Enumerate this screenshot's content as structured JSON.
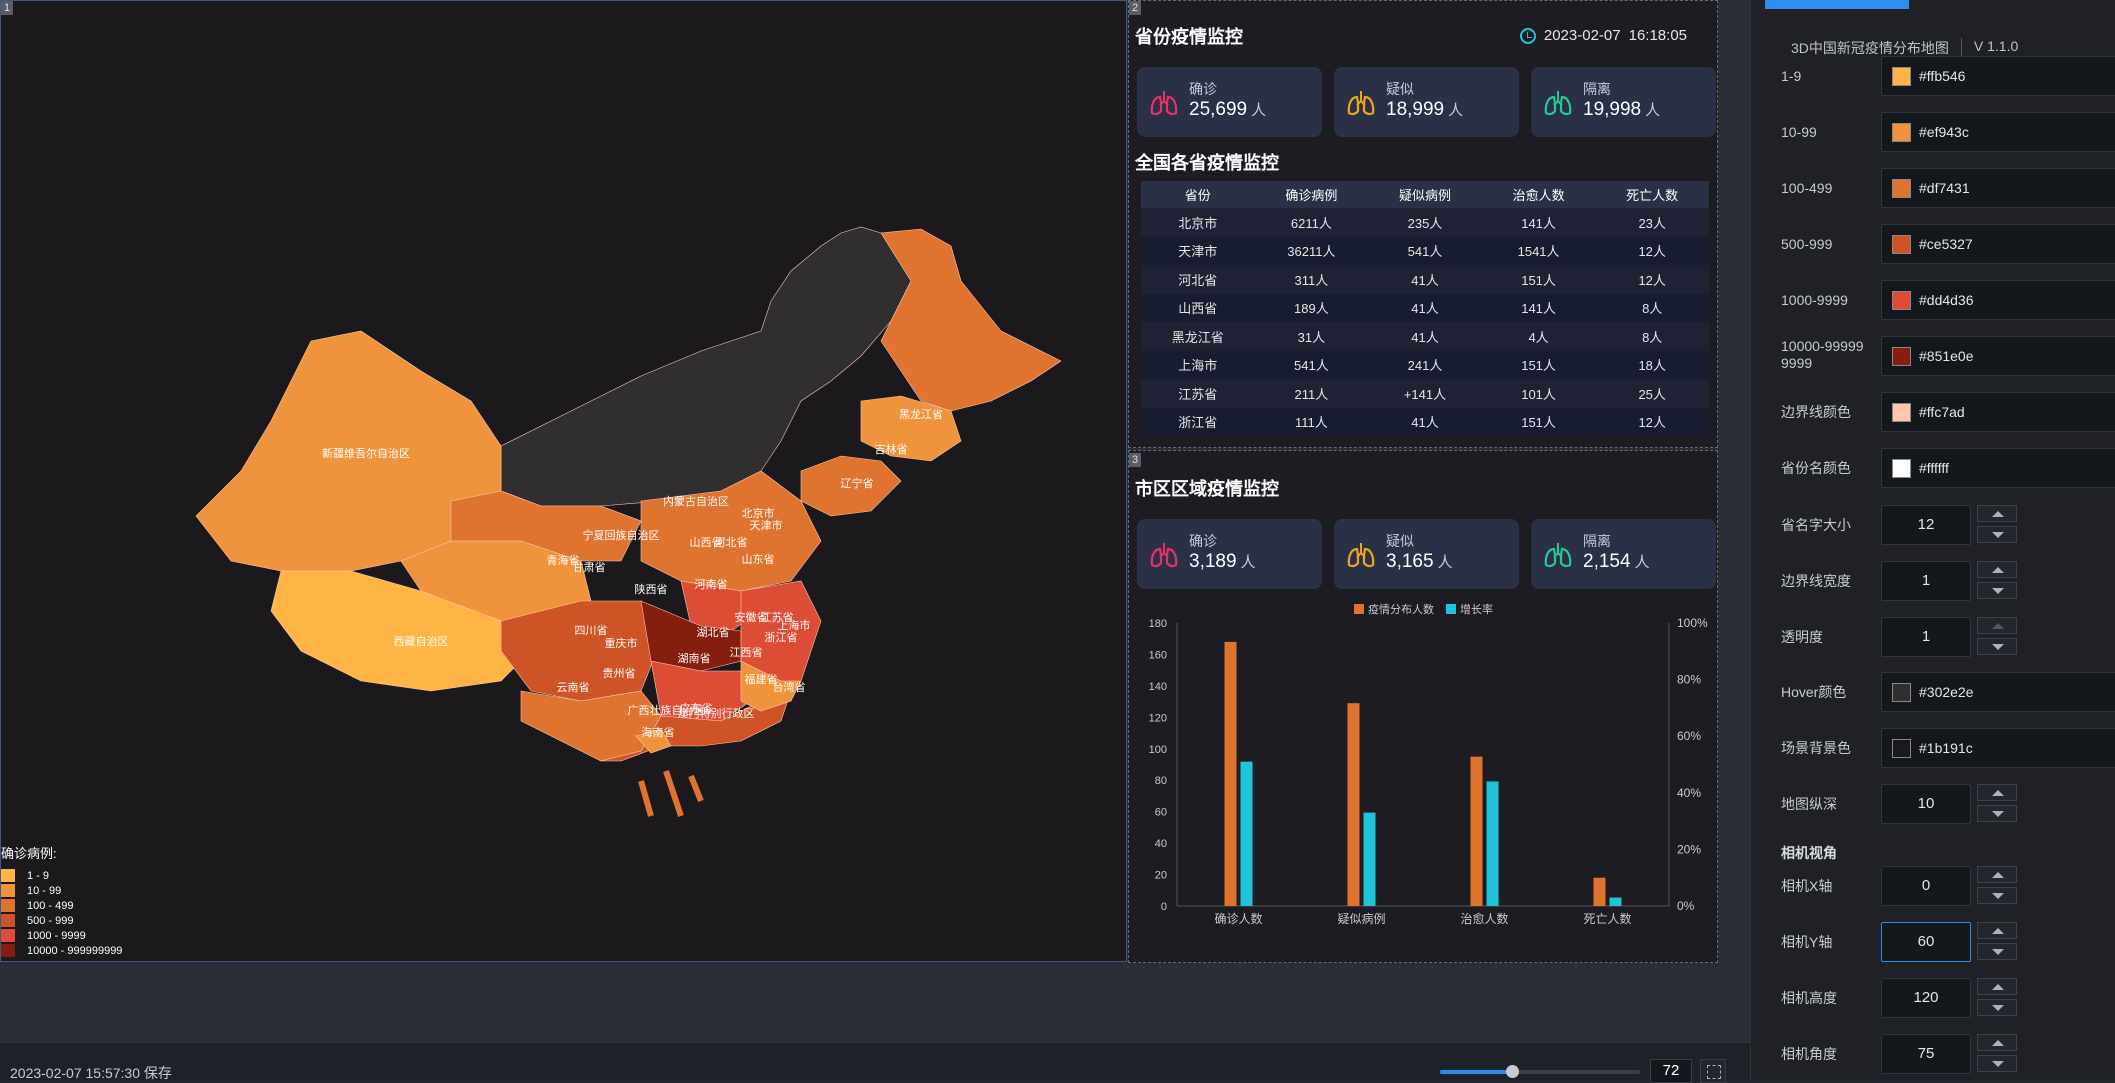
{
  "map": {
    "corner": "1",
    "legend_title": "确诊病例:",
    "legend": [
      {
        "label": "1  -  9",
        "color": "#ffb546"
      },
      {
        "label": "10  -  99",
        "color": "#ef943c"
      },
      {
        "label": "100  -  499",
        "color": "#df7431"
      },
      {
        "label": "500  -  999",
        "color": "#ce5327"
      },
      {
        "label": "1000  -  9999",
        "color": "#dd4d36"
      },
      {
        "label": "10000  -  999999999",
        "color": "#851e0e"
      }
    ],
    "provinces": [
      "新疆维吾尔自治区",
      "西藏自治区",
      "青海省",
      "甘肃省",
      "宁夏回族自治区",
      "内蒙古自治区",
      "黑龙江省",
      "吉林省",
      "辽宁省",
      "北京市",
      "天津市",
      "河北省",
      "山西省",
      "山东省",
      "陕西省",
      "河南省",
      "四川省",
      "重庆市",
      "湖北省",
      "安徽省",
      "江苏省",
      "上海市",
      "浙江省",
      "湖南省",
      "江西省",
      "贵州省",
      "云南省",
      "广西壮族自治区",
      "广东省",
      "福建省",
      "台湾省",
      "海南省",
      "澳门特别行政区"
    ]
  },
  "panel2": {
    "corner": "2",
    "title": "省份疫情监控",
    "date": "2023-02-07",
    "time": "16:18:05",
    "stats": [
      {
        "label": "确诊",
        "value": "25,699",
        "unit": "人",
        "color": "#e8306a"
      },
      {
        "label": "疑似",
        "value": "18,999",
        "unit": "人",
        "color": "#f0a41c"
      },
      {
        "label": "隔离",
        "value": "19,998",
        "unit": "人",
        "color": "#27c896"
      }
    ],
    "table_title": "全国各省疫情监控",
    "columns": [
      "省份",
      "确诊病例",
      "疑似病例",
      "治愈人数",
      "死亡人数"
    ],
    "rows": [
      [
        "北京市",
        "6211人",
        "235人",
        "141人",
        "23人"
      ],
      [
        "天津市",
        "36211人",
        "541人",
        "1541人",
        "12人"
      ],
      [
        "河北省",
        "311人",
        "41人",
        "151人",
        "12人"
      ],
      [
        "山西省",
        "189人",
        "41人",
        "141人",
        "8人"
      ],
      [
        "黑龙江省",
        "31人",
        "41人",
        "4人",
        "8人"
      ],
      [
        "上海市",
        "541人",
        "241人",
        "151人",
        "18人"
      ],
      [
        "江苏省",
        "211人",
        "+141人",
        "101人",
        "25人"
      ],
      [
        "浙江省",
        "111人",
        "41人",
        "151人",
        "12人"
      ]
    ]
  },
  "panel3": {
    "corner": "3",
    "title": "市区区域疫情监控",
    "stats": [
      {
        "label": "确诊",
        "value": "3,189",
        "unit": "人",
        "color": "#e8306a"
      },
      {
        "label": "疑似",
        "value": "3,165",
        "unit": "人",
        "color": "#f0a41c"
      },
      {
        "label": "隔离",
        "value": "2,154",
        "unit": "人",
        "color": "#27c896"
      }
    ]
  },
  "chart_data": {
    "type": "bar",
    "categories": [
      "确诊人数",
      "疑似病例",
      "治愈人数",
      "死亡人数"
    ],
    "series": [
      {
        "name": "疫情分布人数",
        "axis": "left",
        "color": "#df7431",
        "values": [
          168,
          129,
          95,
          18
        ]
      },
      {
        "name": "增长率",
        "axis": "right",
        "color": "#1fc4d8",
        "values": [
          0.51,
          0.33,
          0.44,
          0.03
        ]
      }
    ],
    "ylim": [
      0,
      180
    ],
    "yticks": [
      "0",
      "20",
      "40",
      "60",
      "80",
      "100",
      "120",
      "140",
      "160",
      "180"
    ],
    "y2lim": [
      0,
      1
    ],
    "y2ticks": [
      "0%",
      "20%",
      "40%",
      "60%",
      "80%",
      "100%"
    ],
    "legend_position": "top-center"
  },
  "properties": {
    "app_title": "3D中国新冠疫情分布地图",
    "version": "V 1.1.0",
    "color_rows": [
      {
        "label": "1-9",
        "value": "#ffb546"
      },
      {
        "label": "10-99",
        "value": "#ef943c"
      },
      {
        "label": "100-499",
        "value": "#df7431"
      },
      {
        "label": "500-999",
        "value": "#ce5327"
      },
      {
        "label": "1000-9999",
        "value": "#dd4d36"
      },
      {
        "label": "10000-99999\n9999",
        "value": "#851e0e"
      },
      {
        "label": "边界线颜色",
        "value": "#ffc7ad"
      },
      {
        "label": "省份名颜色",
        "value": "#ffffff"
      }
    ],
    "number_rows_1": [
      {
        "label": "省名字大小",
        "value": "12"
      },
      {
        "label": "边界线宽度",
        "value": "1"
      },
      {
        "label": "透明度",
        "value": "1"
      }
    ],
    "color_rows_2": [
      {
        "label": "Hover颜色",
        "value": "#302e2e"
      },
      {
        "label": "场景背景色",
        "value": "#1b191c"
      }
    ],
    "depth": {
      "label": "地图纵深",
      "value": "10"
    },
    "camera_section": "相机视角",
    "camera_rows": [
      {
        "label": "相机X轴",
        "value": "0"
      },
      {
        "label": "相机Y轴",
        "value": "60"
      },
      {
        "label": "相机高度",
        "value": "120"
      },
      {
        "label": "相机角度",
        "value": "75"
      }
    ]
  },
  "bottom": {
    "save_status": "2023-02-07 15:57:30 保存",
    "zoom": "72",
    "zoom_level": 0.36
  }
}
